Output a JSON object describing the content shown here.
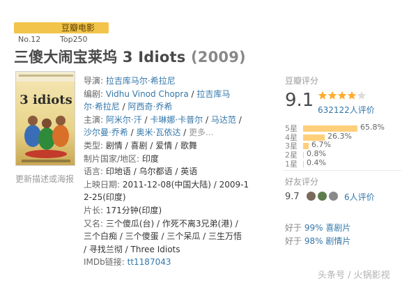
{
  "badge": {
    "label": "豆瓣电影",
    "rank_no": "No.12",
    "rank_list": "Top250"
  },
  "movie": {
    "title": "三傻大闹宝莱坞 3 Idiots",
    "year": "(2009)",
    "poster_caption": "更新描述或海报",
    "poster_title_text": "3 idiots"
  },
  "info": {
    "director_label": "导演:",
    "director": "拉吉库马尔·希拉尼",
    "writer_label": "编剧:",
    "writer_1": "Vidhu Vinod Chopra",
    "writer_2a": "拉吉库马",
    "writer_2b": "尔·希拉尼",
    "writer_3": "阿西奇·乔希",
    "cast_label": "主演:",
    "cast_1": "阿米尔·汗",
    "cast_2": "卡琳娜·卡普尔",
    "cast_3": "马达范",
    "cast_4": "沙尔曼·乔希",
    "cast_5": "奥米·瓦依达",
    "cast_more": "更多...",
    "genre_label": "类型:",
    "genres": "剧情 / 喜剧 / 爱情 / 歌舞",
    "country_label": "制片国家/地区:",
    "country": "印度",
    "lang_label": "语言:",
    "languages": "印地语 / 乌尔都语 / 英语",
    "release_label": "上映日期:",
    "release_1": "2011-12-08(中国大陆) / 2009-1",
    "release_2": "2-25(印度)",
    "length_label": "片长:",
    "length": "171分钟(印度)",
    "aka_label": "又名:",
    "aka_1": "三个傻瓜(台) / 作死不离3兄弟(港) /",
    "aka_2": "三个白痴 / 三个傻蛋 / 三个呆瓜 / 三生万悟",
    "aka_3": "/ 寻找兰彻 / Three Idiots",
    "imdb_label": "IMDb链接:",
    "imdb": "tt1187043"
  },
  "rating": {
    "heading": "豆瓣评分",
    "score": "9.1",
    "votes": "632122人评价",
    "stars": 4.5,
    "star_color": "#ffac2d",
    "bar_color": "#ffcf7a",
    "distribution": [
      {
        "label": "5星",
        "pct": "65.8%",
        "value": 65.8
      },
      {
        "label": "4星",
        "pct": "26.3%",
        "value": 26.3
      },
      {
        "label": "3星",
        "pct": "6.7%",
        "value": 6.7
      },
      {
        "label": "2星",
        "pct": "0.8%",
        "value": 0.8
      },
      {
        "label": "1星",
        "pct": "0.4%",
        "value": 0.4
      }
    ]
  },
  "friends": {
    "heading": "好友评分",
    "score": "9.7",
    "count": "6人评价"
  },
  "better_than": [
    {
      "prefix": "好于",
      "pct": "99%",
      "category": "喜剧片"
    },
    {
      "prefix": "好于",
      "pct": "98%",
      "category": "剧情片"
    }
  ],
  "watermark": "头条号 / 火锅影视"
}
